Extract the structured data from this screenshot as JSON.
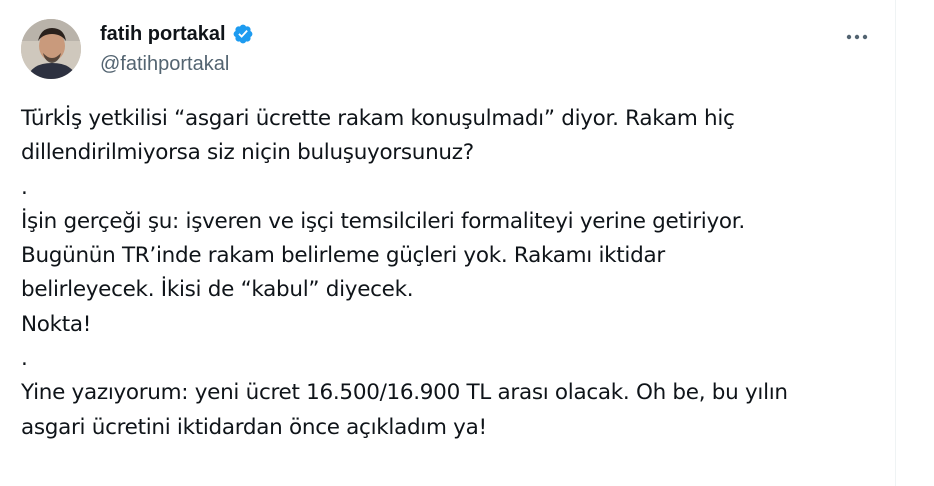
{
  "author": {
    "display_name": "fatih portakal",
    "handle": "@fatihportakal",
    "avatar_icon": "profile-photo",
    "verified_icon": "verified-badge-icon",
    "verified_color": "#1d9bf0"
  },
  "actions": {
    "more_icon": "more-options-icon"
  },
  "tweet": {
    "lines": [
      "Türkİş yetkilisi “asgari ücrette rakam konuşulmadı” diyor. Rakam hiç",
      "dillendirilmiyorsa siz niçin buluşuyorsunuz?",
      ".",
      "İşin gerçeği şu: işveren ve işçi temsilcileri formaliteyi yerine getiriyor.",
      "Bugünün TR’inde rakam belirleme güçleri yok. Rakamı iktidar",
      "belirleyecek. İkisi de “kabul” diyecek.",
      "Nokta!",
      ".",
      "Yine yazıyorum: yeni ücret 16.500/16.900 TL arası olacak. Oh be, bu yılın",
      "asgari ücretini iktidardan önce açıkladım ya!"
    ]
  },
  "colors": {
    "text_primary": "#0f1419",
    "text_secondary": "#536471",
    "accent": "#1d9bf0"
  }
}
